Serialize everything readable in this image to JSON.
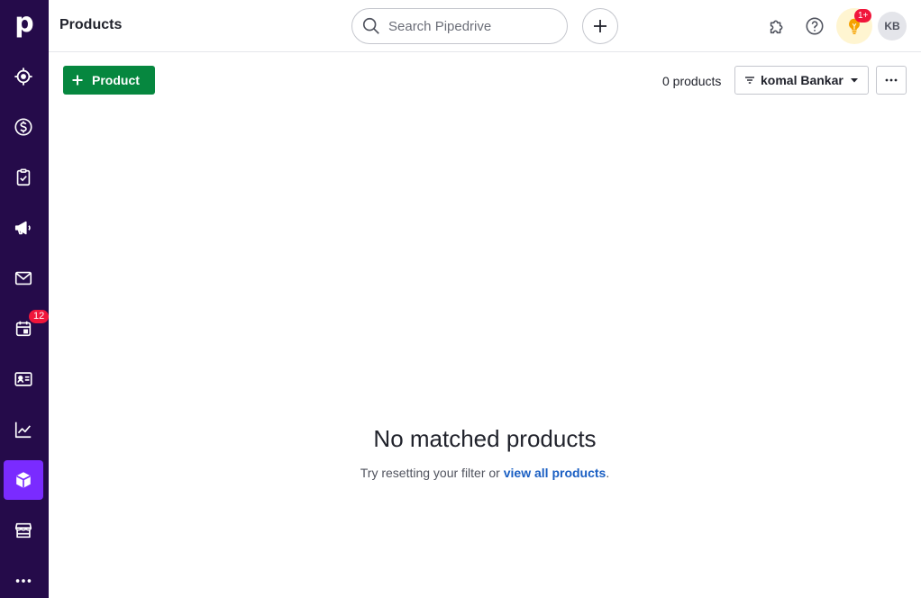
{
  "app": {
    "logo_letter": "p",
    "title": "Products"
  },
  "sidebar": {
    "items": [
      {
        "name": "leads",
        "icon": "target-icon"
      },
      {
        "name": "deals",
        "icon": "dollar-circle-icon"
      },
      {
        "name": "projects",
        "icon": "clipboard-check-icon"
      },
      {
        "name": "campaigns",
        "icon": "megaphone-icon"
      },
      {
        "name": "mail",
        "icon": "envelope-icon"
      },
      {
        "name": "activities",
        "icon": "calendar-icon",
        "badge": "12"
      },
      {
        "name": "contacts",
        "icon": "contact-card-icon"
      },
      {
        "name": "insights",
        "icon": "trend-chart-icon"
      },
      {
        "name": "products",
        "icon": "box-icon",
        "active": true
      },
      {
        "name": "marketplace",
        "icon": "store-icon"
      },
      {
        "name": "more",
        "icon": "more-dots-icon"
      }
    ]
  },
  "topbar": {
    "search_placeholder": "Search Pipedrive",
    "notification_badge": "1+",
    "avatar_initials": "KB"
  },
  "toolbar": {
    "add_button_label": "Product",
    "product_count": "0 products",
    "filter_label": "komal Bankar"
  },
  "empty_state": {
    "title": "No matched products",
    "text_before": "Try resetting your filter or ",
    "link_text": "view all products",
    "text_after": "."
  },
  "colors": {
    "sidebar_bg": "#250b4a",
    "sidebar_active": "#7a2bff",
    "primary_button": "#06873f",
    "link": "#1a5fc3",
    "badge": "#f0163b"
  }
}
